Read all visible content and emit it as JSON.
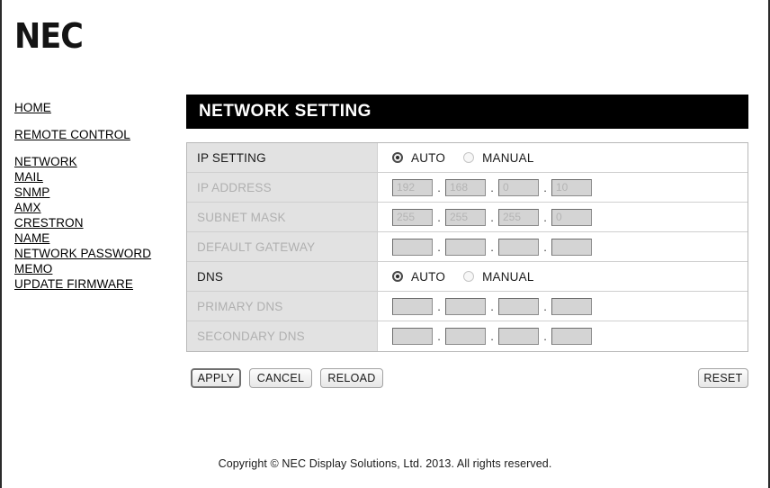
{
  "brand": {
    "logo_text": "NEC"
  },
  "sidebar": {
    "top_items": [
      {
        "label": "HOME",
        "name": "sidebar-item-home"
      },
      {
        "label": "REMOTE CONTROL",
        "name": "sidebar-item-remote-control"
      }
    ],
    "group_items": [
      {
        "label": "NETWORK",
        "name": "sidebar-item-network"
      },
      {
        "label": "MAIL",
        "name": "sidebar-item-mail"
      },
      {
        "label": "SNMP",
        "name": "sidebar-item-snmp"
      },
      {
        "label": "AMX",
        "name": "sidebar-item-amx"
      },
      {
        "label": "CRESTRON",
        "name": "sidebar-item-crestron"
      },
      {
        "label": "NAME",
        "name": "sidebar-item-name"
      },
      {
        "label": "NETWORK PASSWORD",
        "name": "sidebar-item-network-password"
      },
      {
        "label": "MEMO",
        "name": "sidebar-item-memo"
      },
      {
        "label": "UPDATE FIRMWARE",
        "name": "sidebar-item-update-firmware"
      }
    ]
  },
  "header": {
    "title": "NETWORK SETTING"
  },
  "form": {
    "ip_setting": {
      "label": "IP SETTING",
      "disabled": false,
      "auto_label": "AUTO",
      "manual_label": "MANUAL",
      "selected": "AUTO"
    },
    "ip_address": {
      "label": "IP ADDRESS",
      "disabled": true,
      "octets": [
        "192",
        "168",
        "0",
        "10"
      ]
    },
    "subnet_mask": {
      "label": "SUBNET MASK",
      "disabled": true,
      "octets": [
        "255",
        "255",
        "255",
        "0"
      ]
    },
    "default_gateway": {
      "label": "DEFAULT GATEWAY",
      "disabled": true,
      "octets": [
        "",
        "",
        "",
        ""
      ]
    },
    "dns": {
      "label": "DNS",
      "disabled": false,
      "auto_label": "AUTO",
      "manual_label": "MANUAL",
      "selected": "AUTO"
    },
    "primary_dns": {
      "label": "PRIMARY DNS",
      "disabled": true,
      "octets": [
        "",
        "",
        "",
        ""
      ]
    },
    "secondary_dns": {
      "label": "SECONDARY DNS",
      "disabled": true,
      "octets": [
        "",
        "",
        "",
        ""
      ]
    },
    "separator": "."
  },
  "buttons": {
    "apply": "APPLY",
    "cancel": "CANCEL",
    "reload": "RELOAD",
    "reset": "RESET"
  },
  "footer": {
    "copyright": "Copyright © NEC Display Solutions, Ltd. 2013. All rights reserved."
  },
  "colors": {
    "header_bar": "#000000",
    "label_cell": "#e2e2e2",
    "input_fill": "#d4d4d4",
    "disabled_text": "#b0b0b0",
    "page_border": "#2b2b2b"
  }
}
